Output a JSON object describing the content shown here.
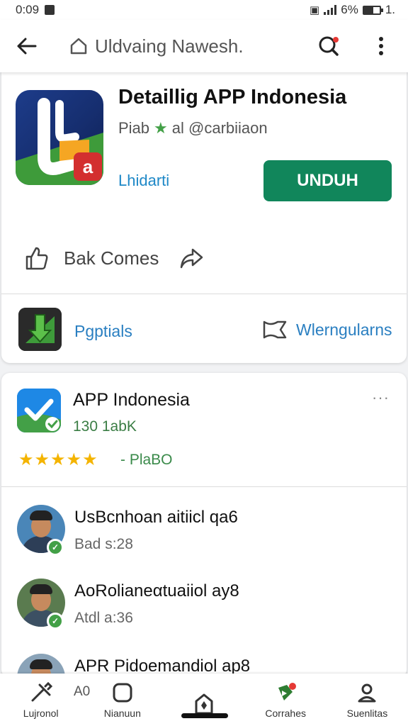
{
  "status_bar": {
    "time": "0:09",
    "battery_pct": "6%",
    "battery_extra": "1."
  },
  "top_bar": {
    "breadcrumb": "Uldvaing Nawesh."
  },
  "app": {
    "title": "Detaillig APP Indonesia",
    "subtitle_prefix": "Piab",
    "subtitle_suffix": "al @carbiiaon",
    "link": "Lhidarti",
    "install_label": "UNDUH",
    "action_label": "Bak Comes"
  },
  "features": {
    "left_label": "Pgptials",
    "right_label": "Wlerngularns"
  },
  "review_card": {
    "title": "APP Indonesia",
    "subtitle": "130 1abK",
    "more": "···",
    "stars": "★★★★★",
    "rating_text": "- PlaBO"
  },
  "users": [
    {
      "name": "UsBcnhoan aitiicl qa6",
      "time": "Bad  s:28"
    },
    {
      "name": "AoRolianeαtuaiiol ay8",
      "time": "Atdl  a:36"
    },
    {
      "name": "APR Pidoemandiol ap8",
      "time": ""
    }
  ],
  "bottom_nav": {
    "overlay_text": "A0",
    "items": [
      {
        "label": "Lujronol",
        "icon": "tools-icon"
      },
      {
        "label": "Nianuun",
        "icon": "square-icon"
      },
      {
        "label": "",
        "icon": "house-icon"
      },
      {
        "label": "Corrahes",
        "icon": "flag-icon"
      },
      {
        "label": "Suenlitas",
        "icon": "person-icon"
      }
    ]
  },
  "colors": {
    "install": "#11865b",
    "link": "#1e88c7",
    "star": "#f4b400",
    "accent_green": "#43a047"
  }
}
